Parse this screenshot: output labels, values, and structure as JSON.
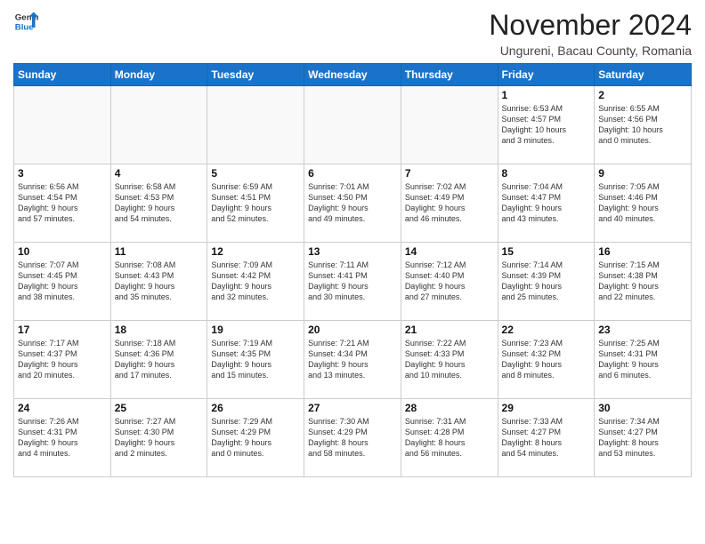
{
  "header": {
    "logo_line1": "General",
    "logo_line2": "Blue",
    "month_title": "November 2024",
    "location": "Ungureni, Bacau County, Romania"
  },
  "weekdays": [
    "Sunday",
    "Monday",
    "Tuesday",
    "Wednesday",
    "Thursday",
    "Friday",
    "Saturday"
  ],
  "weeks": [
    [
      {
        "day": "",
        "info": ""
      },
      {
        "day": "",
        "info": ""
      },
      {
        "day": "",
        "info": ""
      },
      {
        "day": "",
        "info": ""
      },
      {
        "day": "",
        "info": ""
      },
      {
        "day": "1",
        "info": "Sunrise: 6:53 AM\nSunset: 4:57 PM\nDaylight: 10 hours\nand 3 minutes."
      },
      {
        "day": "2",
        "info": "Sunrise: 6:55 AM\nSunset: 4:56 PM\nDaylight: 10 hours\nand 0 minutes."
      }
    ],
    [
      {
        "day": "3",
        "info": "Sunrise: 6:56 AM\nSunset: 4:54 PM\nDaylight: 9 hours\nand 57 minutes."
      },
      {
        "day": "4",
        "info": "Sunrise: 6:58 AM\nSunset: 4:53 PM\nDaylight: 9 hours\nand 54 minutes."
      },
      {
        "day": "5",
        "info": "Sunrise: 6:59 AM\nSunset: 4:51 PM\nDaylight: 9 hours\nand 52 minutes."
      },
      {
        "day": "6",
        "info": "Sunrise: 7:01 AM\nSunset: 4:50 PM\nDaylight: 9 hours\nand 49 minutes."
      },
      {
        "day": "7",
        "info": "Sunrise: 7:02 AM\nSunset: 4:49 PM\nDaylight: 9 hours\nand 46 minutes."
      },
      {
        "day": "8",
        "info": "Sunrise: 7:04 AM\nSunset: 4:47 PM\nDaylight: 9 hours\nand 43 minutes."
      },
      {
        "day": "9",
        "info": "Sunrise: 7:05 AM\nSunset: 4:46 PM\nDaylight: 9 hours\nand 40 minutes."
      }
    ],
    [
      {
        "day": "10",
        "info": "Sunrise: 7:07 AM\nSunset: 4:45 PM\nDaylight: 9 hours\nand 38 minutes."
      },
      {
        "day": "11",
        "info": "Sunrise: 7:08 AM\nSunset: 4:43 PM\nDaylight: 9 hours\nand 35 minutes."
      },
      {
        "day": "12",
        "info": "Sunrise: 7:09 AM\nSunset: 4:42 PM\nDaylight: 9 hours\nand 32 minutes."
      },
      {
        "day": "13",
        "info": "Sunrise: 7:11 AM\nSunset: 4:41 PM\nDaylight: 9 hours\nand 30 minutes."
      },
      {
        "day": "14",
        "info": "Sunrise: 7:12 AM\nSunset: 4:40 PM\nDaylight: 9 hours\nand 27 minutes."
      },
      {
        "day": "15",
        "info": "Sunrise: 7:14 AM\nSunset: 4:39 PM\nDaylight: 9 hours\nand 25 minutes."
      },
      {
        "day": "16",
        "info": "Sunrise: 7:15 AM\nSunset: 4:38 PM\nDaylight: 9 hours\nand 22 minutes."
      }
    ],
    [
      {
        "day": "17",
        "info": "Sunrise: 7:17 AM\nSunset: 4:37 PM\nDaylight: 9 hours\nand 20 minutes."
      },
      {
        "day": "18",
        "info": "Sunrise: 7:18 AM\nSunset: 4:36 PM\nDaylight: 9 hours\nand 17 minutes."
      },
      {
        "day": "19",
        "info": "Sunrise: 7:19 AM\nSunset: 4:35 PM\nDaylight: 9 hours\nand 15 minutes."
      },
      {
        "day": "20",
        "info": "Sunrise: 7:21 AM\nSunset: 4:34 PM\nDaylight: 9 hours\nand 13 minutes."
      },
      {
        "day": "21",
        "info": "Sunrise: 7:22 AM\nSunset: 4:33 PM\nDaylight: 9 hours\nand 10 minutes."
      },
      {
        "day": "22",
        "info": "Sunrise: 7:23 AM\nSunset: 4:32 PM\nDaylight: 9 hours\nand 8 minutes."
      },
      {
        "day": "23",
        "info": "Sunrise: 7:25 AM\nSunset: 4:31 PM\nDaylight: 9 hours\nand 6 minutes."
      }
    ],
    [
      {
        "day": "24",
        "info": "Sunrise: 7:26 AM\nSunset: 4:31 PM\nDaylight: 9 hours\nand 4 minutes."
      },
      {
        "day": "25",
        "info": "Sunrise: 7:27 AM\nSunset: 4:30 PM\nDaylight: 9 hours\nand 2 minutes."
      },
      {
        "day": "26",
        "info": "Sunrise: 7:29 AM\nSunset: 4:29 PM\nDaylight: 9 hours\nand 0 minutes."
      },
      {
        "day": "27",
        "info": "Sunrise: 7:30 AM\nSunset: 4:29 PM\nDaylight: 8 hours\nand 58 minutes."
      },
      {
        "day": "28",
        "info": "Sunrise: 7:31 AM\nSunset: 4:28 PM\nDaylight: 8 hours\nand 56 minutes."
      },
      {
        "day": "29",
        "info": "Sunrise: 7:33 AM\nSunset: 4:27 PM\nDaylight: 8 hours\nand 54 minutes."
      },
      {
        "day": "30",
        "info": "Sunrise: 7:34 AM\nSunset: 4:27 PM\nDaylight: 8 hours\nand 53 minutes."
      }
    ]
  ]
}
